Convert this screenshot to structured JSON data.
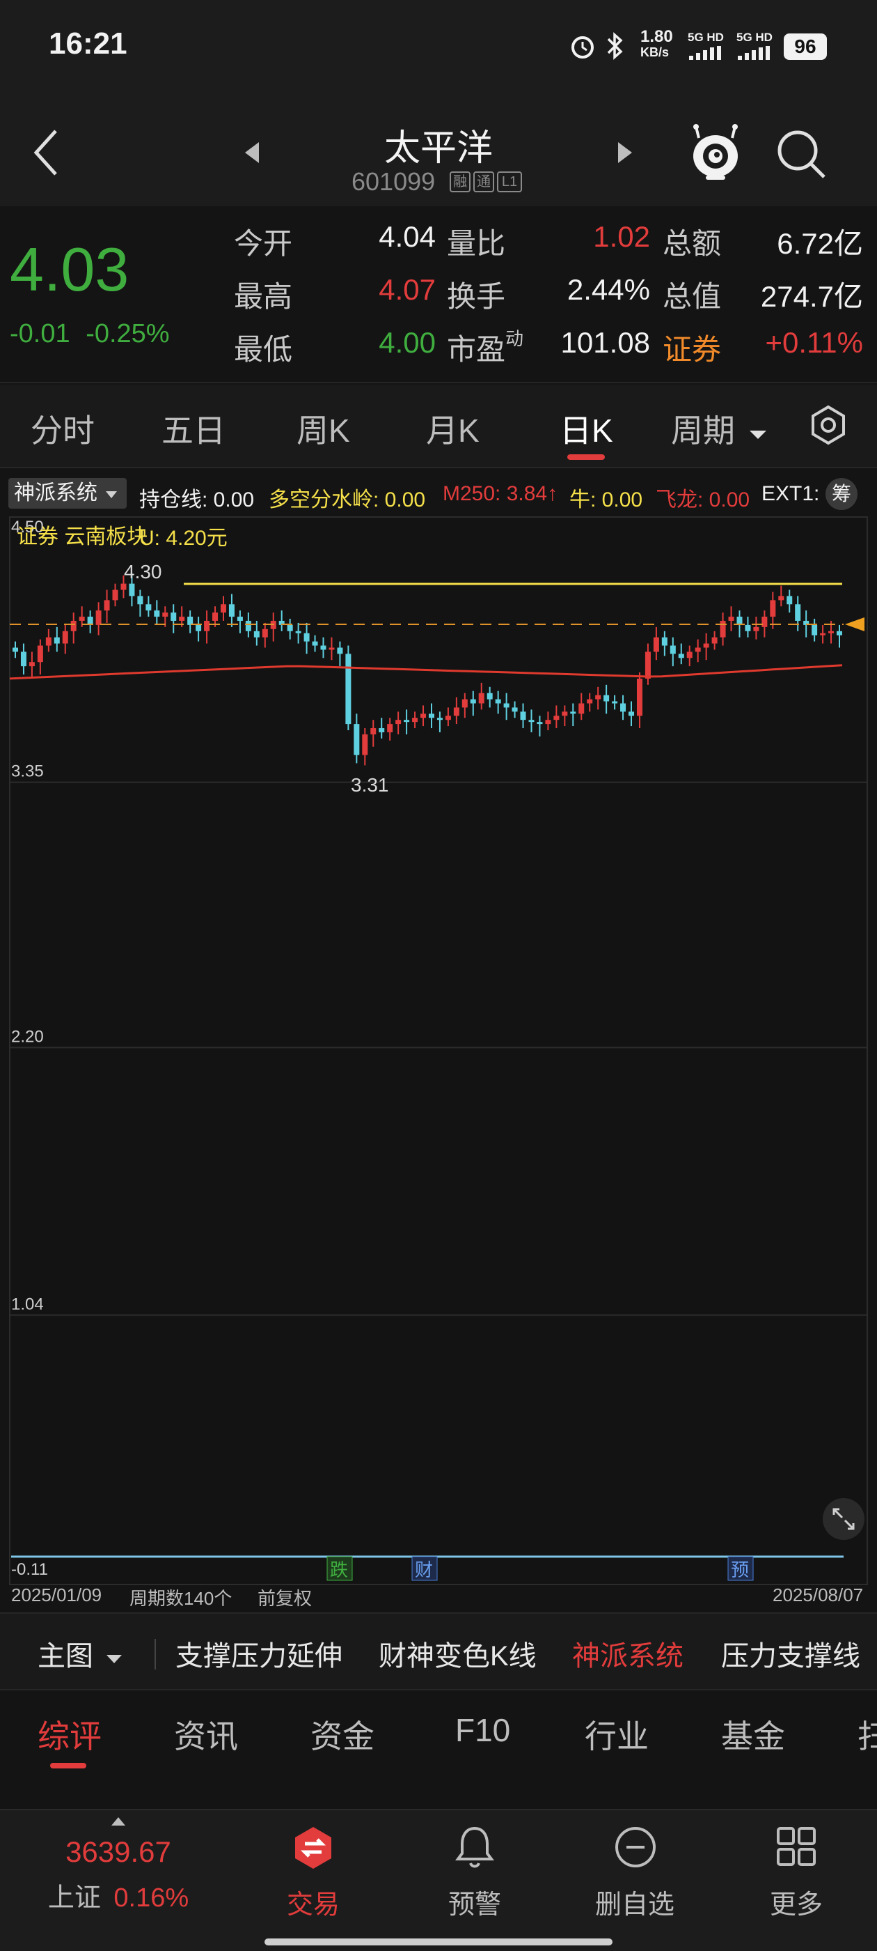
{
  "status_bar": {
    "time": "16:21",
    "net_speed": "1.80",
    "net_unit": "KB/s",
    "sim1": "5G HD",
    "sim2": "5G HD",
    "battery": "96"
  },
  "header": {
    "stock_name": "太平洋",
    "stock_code": "601099",
    "tags": [
      "融",
      "通",
      "L1"
    ]
  },
  "quote": {
    "price": "4.03",
    "change": "-0.01",
    "change_pct": "-0.25%",
    "fields": [
      {
        "label": "今开",
        "value": "4.04",
        "color": "#f2f2f2"
      },
      {
        "label": "最高",
        "value": "4.07",
        "color": "#e23c3c"
      },
      {
        "label": "最低",
        "value": "4.00",
        "color": "#3fae3f"
      },
      {
        "label": "量比",
        "value": "1.02",
        "color": "#e23c3c"
      },
      {
        "label": "换手",
        "value": "2.44%",
        "color": "#f2f2f2"
      },
      {
        "label": "市盈",
        "value": "101.08",
        "color": "#f2f2f2",
        "sup": "动"
      },
      {
        "label": "总额",
        "value": "6.72亿",
        "color": "#f2f2f2"
      },
      {
        "label": "总值",
        "value": "274.7亿",
        "color": "#f2f2f2"
      },
      {
        "label": "证券",
        "value": "+0.11%",
        "color": "#e23c3c",
        "label_color": "#f08a2a"
      }
    ]
  },
  "period_tabs": [
    "分时",
    "五日",
    "周K",
    "月K",
    "日K",
    "周期"
  ],
  "period_active": "日K",
  "indicators": {
    "system": "神派系统",
    "items": [
      {
        "text": "持仓线: 0.00",
        "color": "#f2f2f2"
      },
      {
        "text": "多空分水岭: 0.00",
        "color": "#f5e04a"
      },
      {
        "text": "M250: 3.84↑",
        "color": "#e23c3c"
      },
      {
        "text": "牛: 0.00",
        "color": "#f5e04a"
      },
      {
        "text": "飞龙: 0.00",
        "color": "#e23c3c"
      },
      {
        "text": "EXT1:",
        "color": "#f2f2f2"
      }
    ],
    "chip_label": "筹"
  },
  "chart_data": {
    "type": "candlestick",
    "y_ticks": [
      "4.50",
      "3.35",
      "2.20",
      "1.04",
      "-0.11"
    ],
    "ylim": [
      -0.11,
      4.5
    ],
    "annotation": "证券 云南板块",
    "annotation2": "U: 4.20元",
    "high_label": "4.30",
    "low_label": "3.31",
    "markers": [
      "跌",
      "财",
      "预"
    ],
    "x_start": "2025/01/09",
    "x_end": "2025/08/07",
    "period_count": "周期数140个",
    "adjust": "前复权",
    "closes": [
      3.95,
      3.88,
      3.9,
      3.98,
      4.02,
      3.99,
      4.05,
      4.1,
      4.12,
      4.08,
      4.15,
      4.2,
      4.25,
      4.28,
      4.22,
      4.18,
      4.15,
      4.12,
      4.14,
      4.1,
      4.12,
      4.08,
      4.05,
      4.1,
      4.14,
      4.18,
      4.12,
      4.1,
      4.05,
      4.02,
      4.06,
      4.1,
      4.08,
      4.05,
      4.04,
      4.0,
      3.98,
      3.96,
      3.97,
      3.94,
      3.6,
      3.45,
      3.55,
      3.58,
      3.56,
      3.6,
      3.62,
      3.61,
      3.63,
      3.65,
      3.63,
      3.62,
      3.64,
      3.68,
      3.72,
      3.7,
      3.75,
      3.72,
      3.7,
      3.68,
      3.66,
      3.62,
      3.61,
      3.6,
      3.62,
      3.64,
      3.66,
      3.65,
      3.7,
      3.72,
      3.74,
      3.71,
      3.7,
      3.66,
      3.64,
      3.82,
      3.95,
      4.02,
      3.98,
      3.94,
      3.92,
      3.95,
      3.97,
      3.99,
      4.02,
      4.1,
      4.12,
      4.08,
      4.05,
      4.07,
      4.12,
      4.2,
      4.22,
      4.18,
      4.1,
      4.08,
      4.03,
      4.04,
      4.05,
      4.03
    ],
    "m250": [
      3.84
    ]
  },
  "main_tabs": [
    "主图",
    "支撑压力延伸",
    "财神变色K线",
    "神派系统",
    "压力支撑线"
  ],
  "main_tab_active": "神派系统",
  "info_tabs": [
    "综评",
    "资讯",
    "资金",
    "F10",
    "行业",
    "基金",
    "扫"
  ],
  "info_tab_active": "综评",
  "bottom_nav": {
    "index_value": "3639.67",
    "index_name": "上证",
    "index_change": "0.16%",
    "items": [
      "交易",
      "预警",
      "删自选",
      "更多"
    ]
  }
}
